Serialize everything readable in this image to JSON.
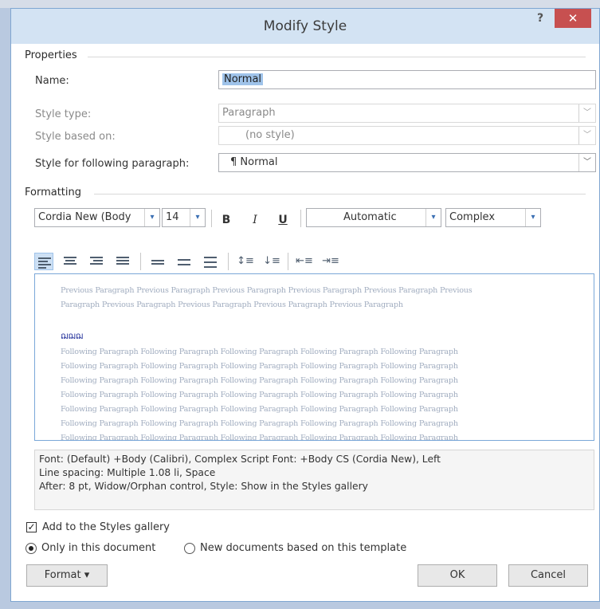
{
  "dialog": {
    "title": "Modify Style",
    "help_label": "?",
    "close_label": "✕"
  },
  "properties": {
    "section_label": "Properties",
    "name_label": "Name:",
    "name_value": "Normal",
    "style_type_label": "Style type:",
    "style_type_value": "Paragraph",
    "based_on_label": "Style based on:",
    "based_on_value": "(no style)",
    "following_label": "Style for following paragraph:",
    "following_value": "Normal",
    "following_glyph": "¶"
  },
  "formatting": {
    "section_label": "Formatting",
    "font": "Cordia New (Body",
    "size": "14",
    "bold": "B",
    "italic": "I",
    "underline": "U",
    "color": "Automatic",
    "script": "Complex"
  },
  "preview": {
    "previous_lines": [
      "Previous Paragraph Previous Paragraph Previous Paragraph Previous Paragraph Previous Paragraph Previous",
      "Paragraph Previous Paragraph Previous Paragraph Previous Paragraph Previous Paragraph"
    ],
    "sample": "ฌฌฌ",
    "following_lines": [
      "Following Paragraph Following Paragraph Following Paragraph Following Paragraph Following Paragraph",
      "Following Paragraph Following Paragraph Following Paragraph Following Paragraph Following Paragraph",
      "Following Paragraph Following Paragraph Following Paragraph Following Paragraph Following Paragraph",
      "Following Paragraph Following Paragraph Following Paragraph Following Paragraph Following Paragraph",
      "Following Paragraph Following Paragraph Following Paragraph Following Paragraph Following Paragraph",
      "Following Paragraph Following Paragraph Following Paragraph Following Paragraph Following Paragraph",
      "Following Paragraph Following Paragraph Following Paragraph Following Paragraph Following Paragraph"
    ]
  },
  "description": {
    "lines": [
      "Font: (Default) +Body (Calibri), Complex Script Font: +Body CS (Cordia New), Left",
      "   Line spacing:  Multiple 1.08 li, Space",
      "   After:  8 pt, Widow/Orphan control, Style: Show in the Styles gallery"
    ]
  },
  "options": {
    "add_gallery_label": "Add to the Styles gallery",
    "add_gallery_checked": true,
    "only_doc_label": "Only in this document",
    "new_docs_label": "New documents based on this template",
    "selected": "only_doc"
  },
  "buttons": {
    "format": "Format",
    "format_arrow": "▾",
    "ok": "OK",
    "cancel": "Cancel"
  },
  "colors": {
    "title_bar": "#d3e3f3",
    "close": "#c75050",
    "preview_text": "#a0acbf",
    "sample_text": "#1f2d99",
    "selection": "#9fc3ea"
  }
}
